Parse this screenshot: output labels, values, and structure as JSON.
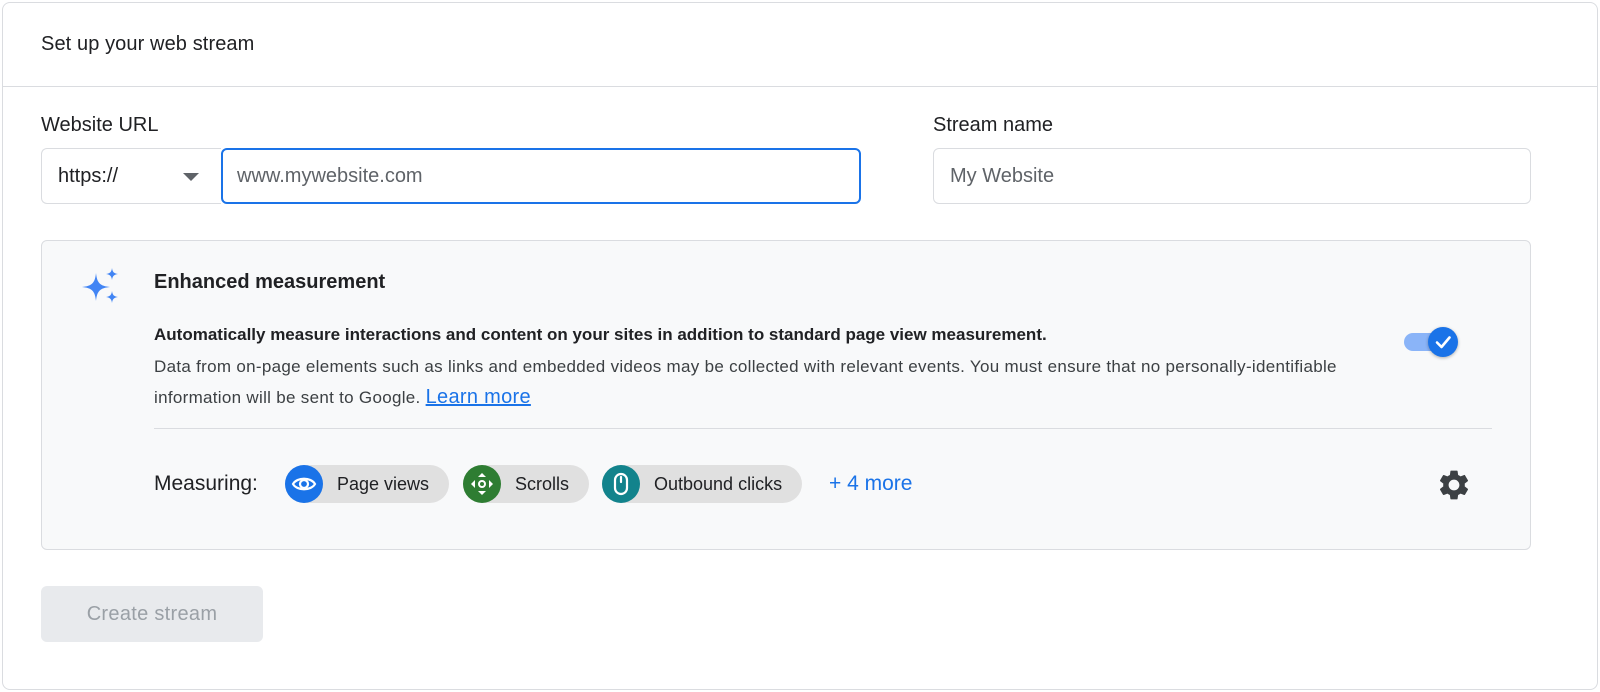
{
  "header": {
    "title": "Set up your web stream"
  },
  "form": {
    "url_label": "Website URL",
    "protocol_value": "https://",
    "url_placeholder": "www.mywebsite.com",
    "url_value": "",
    "stream_name_label": "Stream name",
    "stream_name_placeholder": "My Website",
    "stream_name_value": ""
  },
  "enhanced": {
    "title": "Enhanced measurement",
    "summary": "Automatically measure interactions and content on your sites in addition to standard page view measurement.",
    "description": "Data from on-page elements such as links and embedded videos may be collected with relevant events. You must ensure that no personally-identifiable information will be sent to Google. ",
    "learn_more": "Learn more",
    "toggle_enabled": true,
    "measuring_label": "Measuring:",
    "chips": [
      {
        "label": "Page views",
        "icon": "eye-icon",
        "color": "#1a73e8"
      },
      {
        "label": "Scrolls",
        "icon": "scroll-arrows-icon",
        "color": "#34a853"
      },
      {
        "label": "Outbound clicks",
        "icon": "mouse-icon",
        "color": "#12838c"
      }
    ],
    "more_label": "+ 4 more"
  },
  "actions": {
    "create_label": "Create stream",
    "create_disabled": true
  },
  "colors": {
    "accent": "#1a73e8",
    "border": "#dadce0",
    "panel_bg": "#f8f9fa"
  }
}
